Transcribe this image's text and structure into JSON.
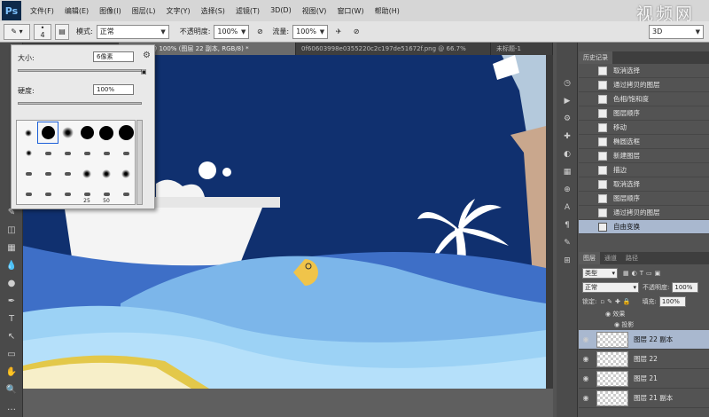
{
  "app": {
    "logo": "Ps",
    "watermark": "视频网"
  },
  "menu": [
    "文件(F)",
    "编辑(E)",
    "图像(I)",
    "图层(L)",
    "文字(Y)",
    "选择(S)",
    "滤镜(T)",
    "3D(D)",
    "视图(V)",
    "窗口(W)",
    "帮助(H)"
  ],
  "options": {
    "brush_size": "4",
    "mode_label": "模式:",
    "mode_value": "正常",
    "opacity_label": "不透明度:",
    "opacity_value": "100%",
    "flow_label": "流量:",
    "flow_value": "100%",
    "workspace_value": "3D"
  },
  "tabs": [
    {
      "label": "玩了一夏 @ 100% (图层 22 副本, RGB/8) *",
      "active": true
    },
    {
      "label": "0f60603998e0355220c2c197de51672f.png @ 66.7%",
      "active": false
    },
    {
      "label": "未标题-1",
      "active": false
    }
  ],
  "brush_popup": {
    "size_label": "大小:",
    "size_value": "6像素",
    "hardness_label": "硬度:",
    "hardness_value": "100%",
    "brush_sizes": [
      "25",
      "50"
    ]
  },
  "history": {
    "tab_label": "历史记录",
    "items": [
      {
        "label": "取消选择",
        "active": false
      },
      {
        "label": "通过拷贝的图层",
        "active": false
      },
      {
        "label": "色相/饱和度",
        "active": false
      },
      {
        "label": "图层顺序",
        "active": false
      },
      {
        "label": "移动",
        "active": false
      },
      {
        "label": "椭圆选框",
        "active": false
      },
      {
        "label": "新建图层",
        "active": false
      },
      {
        "label": "描边",
        "active": false
      },
      {
        "label": "取消选择",
        "active": false
      },
      {
        "label": "图层顺序",
        "active": false
      },
      {
        "label": "通过拷贝的图层",
        "active": false
      },
      {
        "label": "自由变换",
        "active": true
      }
    ]
  },
  "layers": {
    "tabs": [
      "图层",
      "通道",
      "路径"
    ],
    "kind_label": "类型",
    "blend_value": "正常",
    "opacity_label": "不透明度:",
    "opacity_value": "100%",
    "lock_label": "锁定:",
    "fill_label": "填充:",
    "fill_value": "100%",
    "effects_label": "效果",
    "shadow_label": "投影",
    "rows": [
      {
        "name": "图层 22 副本",
        "active": true
      },
      {
        "name": "图层 22",
        "active": false
      },
      {
        "name": "图层 21",
        "active": false
      },
      {
        "name": "图层 21 副本",
        "active": false
      }
    ]
  }
}
